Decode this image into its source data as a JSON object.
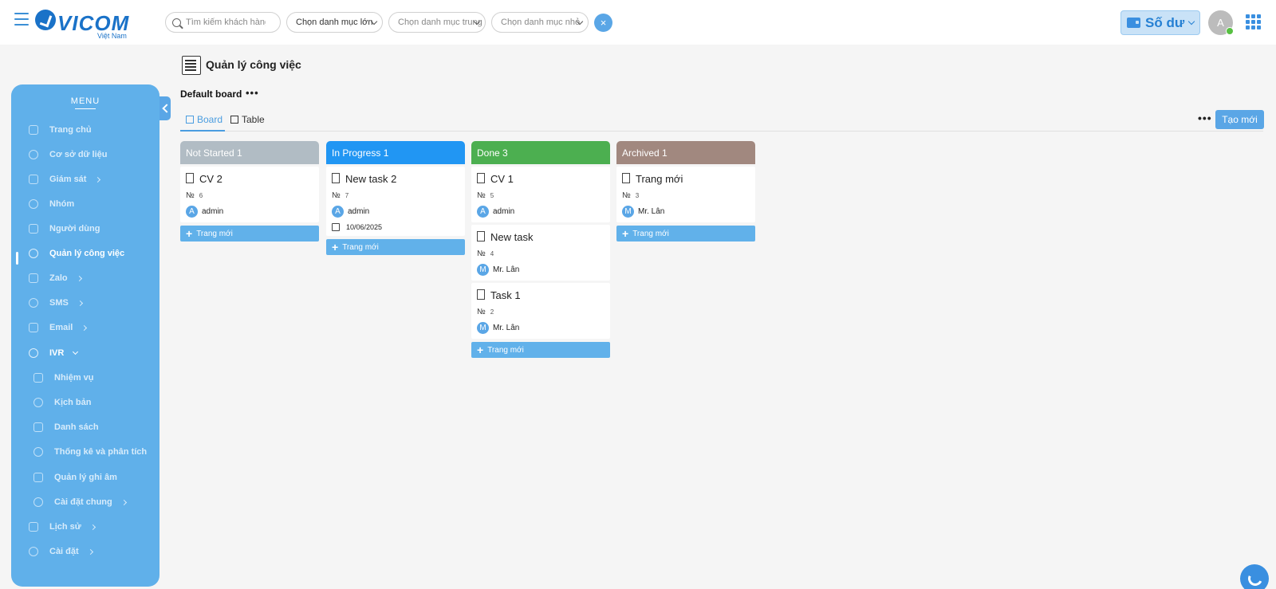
{
  "header": {
    "logo_text": "VICOM",
    "logo_sub": "Việt Nam",
    "search_placeholder": "Tìm kiếm khách hàng",
    "category_large": "Chọn danh mục lớn",
    "category_medium": "Chọn danh mục trung",
    "category_small": "Chọn danh mục nhỏ",
    "clear_label": "×",
    "balance_label": "Số dư",
    "avatar_initial": "A"
  },
  "sidebar": {
    "title": "MENU",
    "items": [
      {
        "label": "Trang chủ",
        "icon": "home-icon"
      },
      {
        "label": "Cơ sở dữ liệu",
        "icon": "user-icon"
      },
      {
        "label": "Giám sát",
        "icon": "monitor-icon",
        "has_children": true
      },
      {
        "label": "Nhóm",
        "icon": "group-icon"
      },
      {
        "label": "Người dùng",
        "icon": "headset-icon"
      },
      {
        "label": "Quản lý công việc",
        "icon": "task-icon",
        "active": true
      },
      {
        "label": "Zalo",
        "icon": "zalo-icon",
        "has_children": true
      },
      {
        "label": "SMS",
        "icon": "phone-icon",
        "has_children": true
      },
      {
        "label": "Email",
        "icon": "mail-icon",
        "has_children": true
      },
      {
        "label": "IVR",
        "icon": "robot-icon",
        "expanded": true
      },
      {
        "label": "Nhiệm vụ",
        "icon": "robot-icon"
      },
      {
        "label": "Kịch bản",
        "icon": "script-icon"
      },
      {
        "label": "Danh sách",
        "icon": "robot-icon"
      },
      {
        "label": "Thống kê và phân tích",
        "icon": "robot-icon"
      },
      {
        "label": "Quản lý ghi âm",
        "icon": "robot-icon"
      },
      {
        "label": "Cài đặt chung",
        "icon": "robot-icon",
        "has_children": true
      },
      {
        "label": "Lịch sử",
        "icon": "history-icon",
        "has_children": true
      },
      {
        "label": "Cài đặt",
        "icon": "gear-icon",
        "has_children": true
      }
    ]
  },
  "page": {
    "title": "Quản lý công việc",
    "board_name": "Default board",
    "more": "•••",
    "tabs": {
      "board": "Board",
      "table": "Table"
    },
    "create_label": "Tạo mới",
    "new_page_label": "Trang mới",
    "no_label": "№"
  },
  "columns": [
    {
      "title": "Not Started 1",
      "color": "#b1bcc4",
      "cards": [
        {
          "title": "CV 2",
          "no": "6",
          "assignee": "admin",
          "initial": "A"
        }
      ]
    },
    {
      "title": "In Progress 1",
      "color": "#2196f3",
      "cards": [
        {
          "title": "New task 2",
          "no": "7",
          "assignee": "admin",
          "initial": "A",
          "date": "10/06/2025"
        }
      ]
    },
    {
      "title": "Done 3",
      "color": "#4caf50",
      "cards": [
        {
          "title": "CV 1",
          "no": "5",
          "assignee": "admin",
          "initial": "A"
        },
        {
          "title": "New task",
          "no": "4",
          "assignee": "Mr. Lân",
          "initial": "M"
        },
        {
          "title": "Task 1",
          "no": "2",
          "assignee": "Mr. Lân",
          "initial": "M"
        }
      ]
    },
    {
      "title": "Archived 1",
      "color": "#a1887f",
      "cards": [
        {
          "title": "Trang mới",
          "no": "3",
          "assignee": "Mr. Lân",
          "initial": "M"
        }
      ]
    }
  ]
}
